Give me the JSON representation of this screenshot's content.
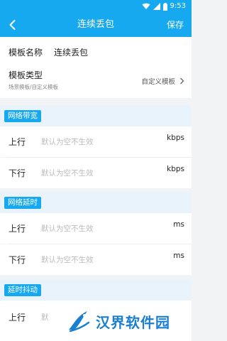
{
  "status_bar": {
    "time": "9:53",
    "icons": [
      "wifi-icon",
      "signal-icon",
      "battery-icon"
    ]
  },
  "app_bar": {
    "title": "连续丢包",
    "save_label": "保存",
    "back_icon": "chevron-left-icon"
  },
  "template_name": {
    "label": "模板名称",
    "value": "连续丢包"
  },
  "template_type": {
    "label": "模板类型",
    "sublabel": "场景模板/自定义模板",
    "value": "自定义模板"
  },
  "sections": [
    {
      "title": "网络带宽",
      "rows": [
        {
          "label": "上行",
          "placeholder": "默认为空不生效",
          "unit": "kbps"
        },
        {
          "label": "下行",
          "placeholder": "默认为空不生效",
          "unit": "kbps"
        }
      ]
    },
    {
      "title": "网络延时",
      "rows": [
        {
          "label": "上行",
          "placeholder": "默认为空不生效",
          "unit": "ms"
        },
        {
          "label": "下行",
          "placeholder": "默认为空不生效",
          "unit": "ms"
        }
      ]
    },
    {
      "title": "延时抖动",
      "rows": [
        {
          "label": "上行",
          "placeholder": "默",
          "unit": ""
        }
      ]
    }
  ],
  "watermark": {
    "text": "汉界软件园"
  },
  "colors": {
    "primary": "#16a9ef",
    "section_bg": "#e9f3fb",
    "page_bg": "#f2f3f5",
    "placeholder": "#bbbbbb",
    "watermark": "#1a7fd1"
  }
}
